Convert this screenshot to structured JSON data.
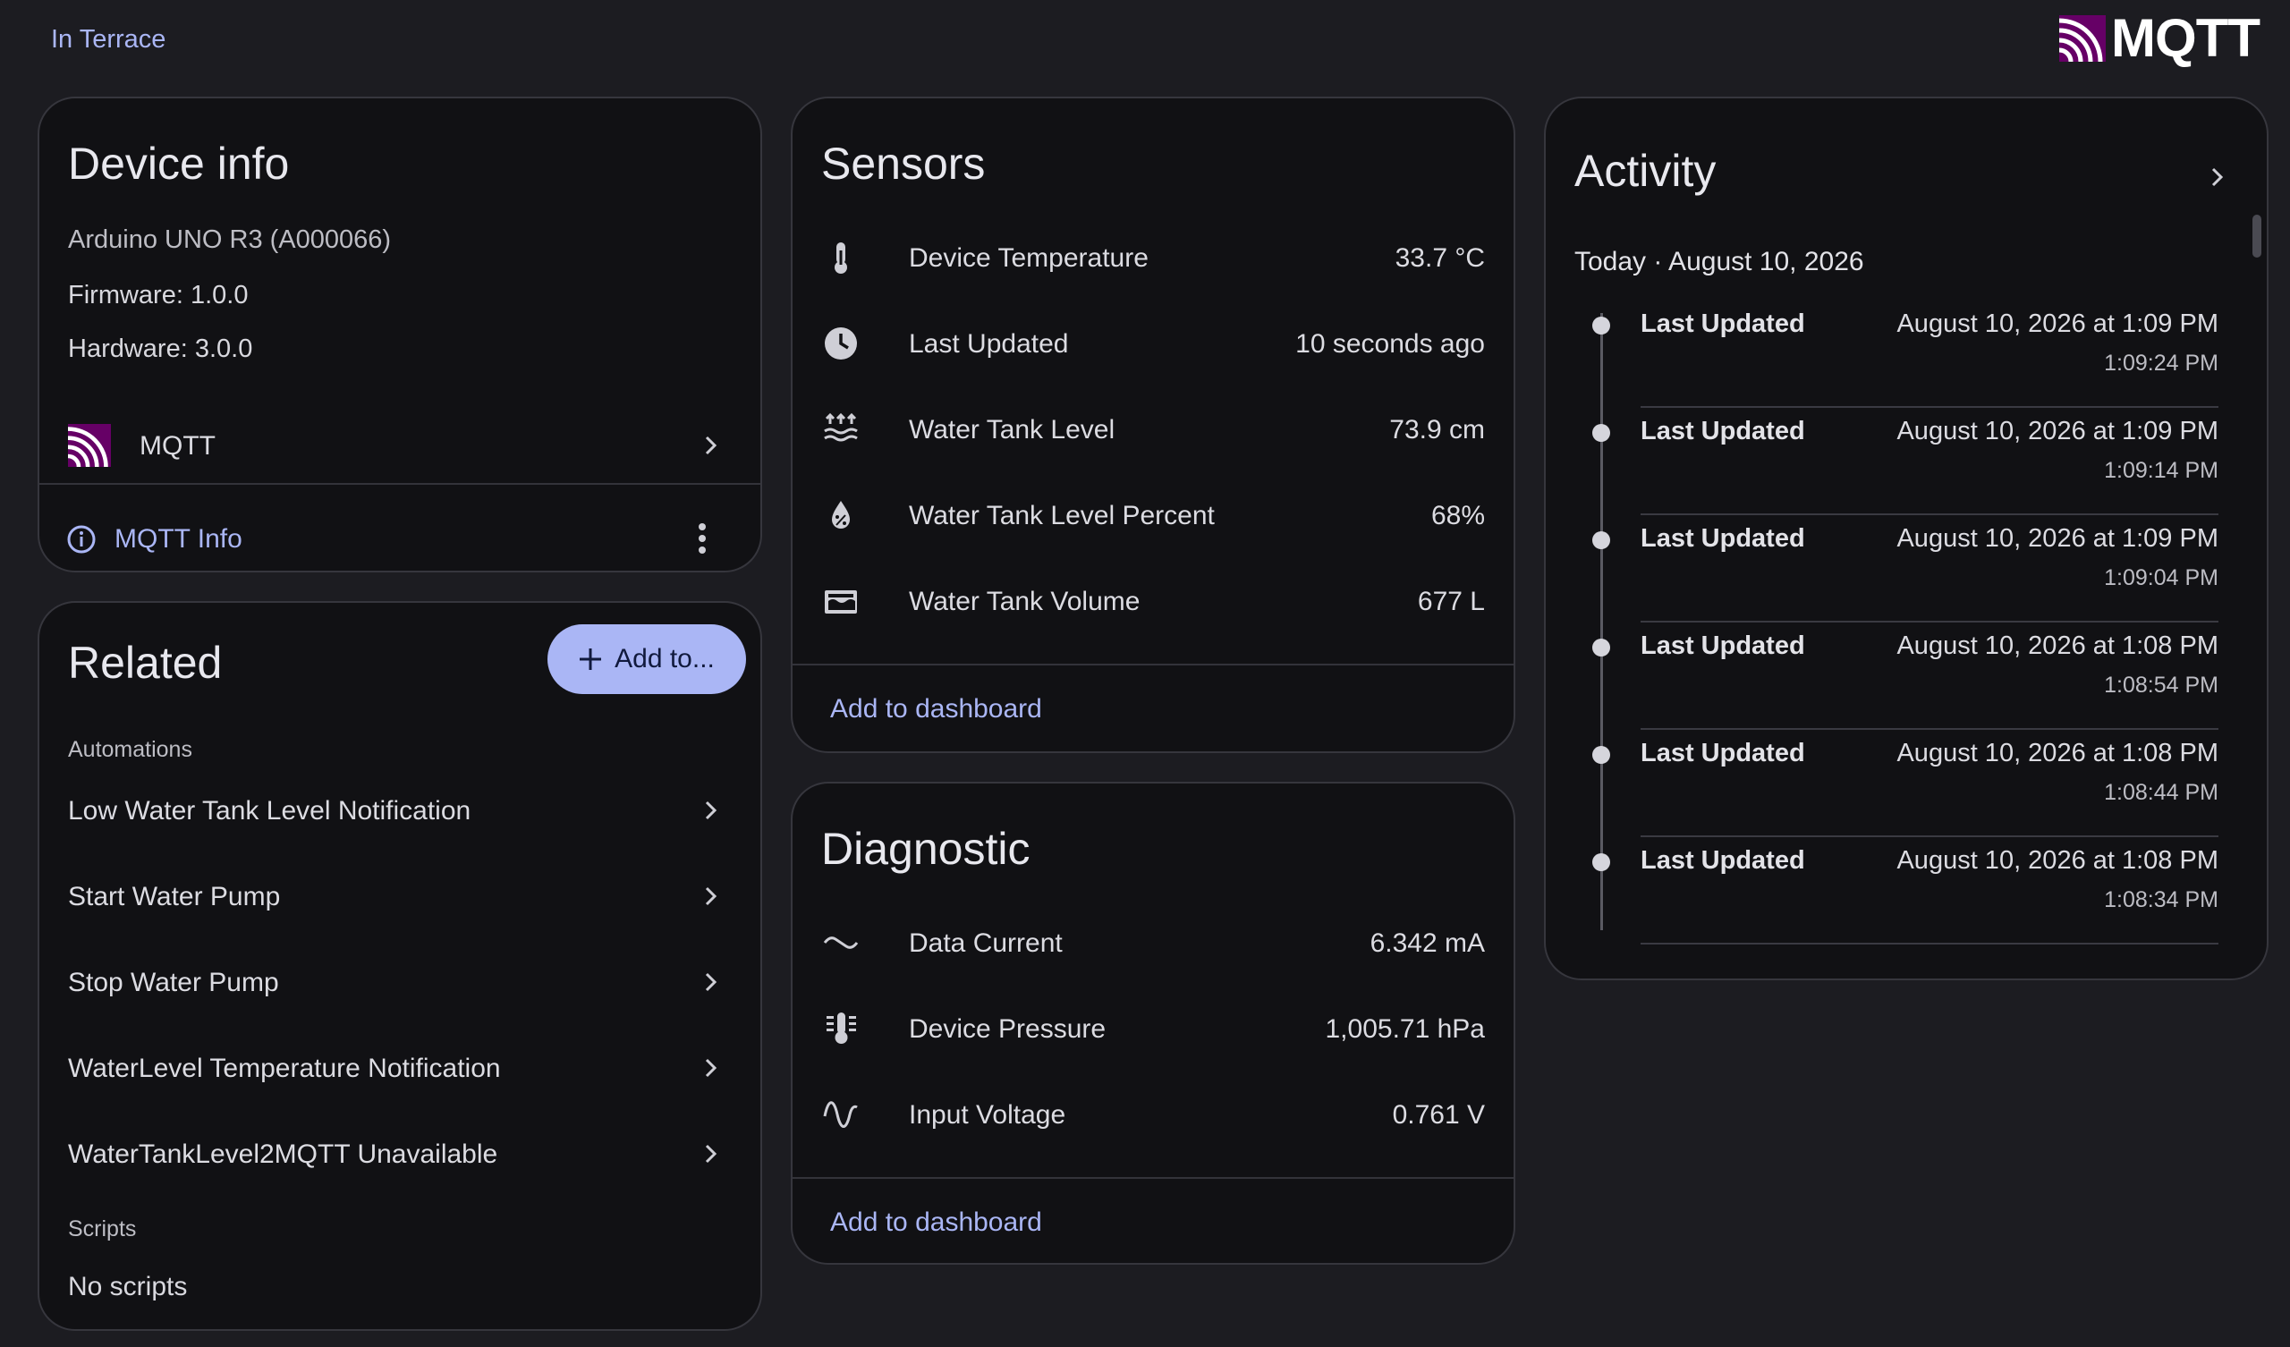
{
  "header": {
    "area_link": "In Terrace",
    "brand": "MQTT"
  },
  "device_info": {
    "title": "Device info",
    "model": "Arduino UNO R3 (A000066)",
    "firmware": "Firmware: 1.0.0",
    "hardware": "Hardware: 3.0.0",
    "integration": "MQTT",
    "info_link": "MQTT Info"
  },
  "related": {
    "title": "Related",
    "add_button": "Add to...",
    "automations_label": "Automations",
    "automations": [
      "Low Water Tank Level Notification",
      "Start Water Pump",
      "Stop Water Pump",
      "WaterLevel Temperature Notification",
      "WaterTankLevel2MQTT Unavailable"
    ],
    "scripts_label": "Scripts",
    "scripts_empty": "No scripts"
  },
  "sensors": {
    "title": "Sensors",
    "rows": [
      {
        "name": "Device Temperature",
        "value": "33.7 °C",
        "icon": "thermometer-icon"
      },
      {
        "name": "Last Updated",
        "value": "10 seconds ago",
        "icon": "clock-icon"
      },
      {
        "name": "Water Tank Level",
        "value": "73.9 cm",
        "icon": "water-level-icon"
      },
      {
        "name": "Water Tank Level Percent",
        "value": "68%",
        "icon": "water-percent-icon"
      },
      {
        "name": "Water Tank Volume",
        "value": "677 L",
        "icon": "tank-icon"
      }
    ],
    "footer": "Add to dashboard"
  },
  "diagnostic": {
    "title": "Diagnostic",
    "rows": [
      {
        "name": "Data Current",
        "value": "6.342 mA",
        "icon": "current-ac-icon"
      },
      {
        "name": "Device Pressure",
        "value": "1,005.71 hPa",
        "icon": "pressure-icon"
      },
      {
        "name": "Input Voltage",
        "value": "0.761 V",
        "icon": "sine-wave-icon"
      }
    ],
    "footer": "Add to dashboard"
  },
  "activity": {
    "title": "Activity",
    "date_header": "Today · August 10, 2026",
    "items": [
      {
        "title": "Last Updated",
        "when": "August 10, 2026 at 1:09 PM",
        "time": "1:09:24 PM"
      },
      {
        "title": "Last Updated",
        "when": "August 10, 2026 at 1:09 PM",
        "time": "1:09:14 PM"
      },
      {
        "title": "Last Updated",
        "when": "August 10, 2026 at 1:09 PM",
        "time": "1:09:04 PM"
      },
      {
        "title": "Last Updated",
        "when": "August 10, 2026 at 1:08 PM",
        "time": "1:08:54 PM"
      },
      {
        "title": "Last Updated",
        "when": "August 10, 2026 at 1:08 PM",
        "time": "1:08:44 PM"
      },
      {
        "title": "Last Updated",
        "when": "August 10, 2026 at 1:08 PM",
        "time": "1:08:34 PM"
      }
    ]
  },
  "colors": {
    "background": "#1c1c21",
    "card": "#111114",
    "accent": "#aab6f5",
    "mqtt_brand": "#660066"
  }
}
